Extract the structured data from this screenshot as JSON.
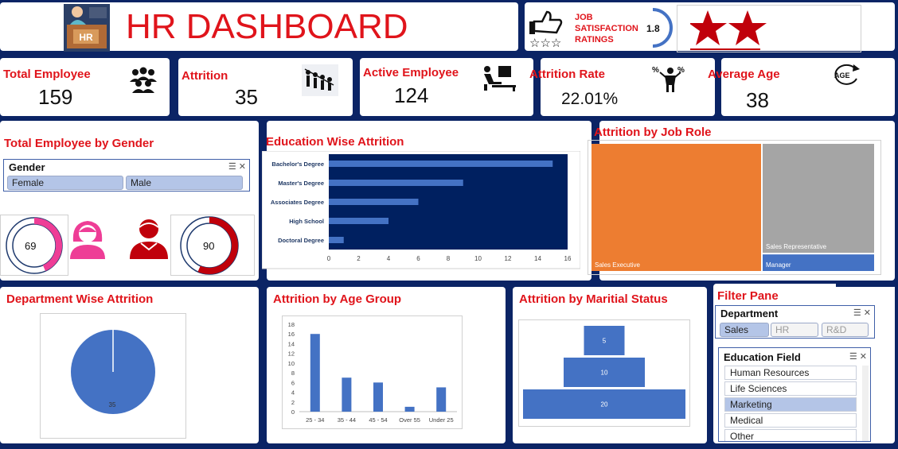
{
  "header": {
    "title": "HR DASHBOARD",
    "rating_label": "JOB SATISFACTION RATINGS",
    "rating_value": "1.8",
    "stars_filled": 2
  },
  "kpis": [
    {
      "label": "Total Employee",
      "value": "159",
      "icon": "people-group-icon"
    },
    {
      "label": "Attrition",
      "value": "35",
      "icon": "attrition-people-icon"
    },
    {
      "label": "Active Employee",
      "value": "124",
      "icon": "desk-worker-icon"
    },
    {
      "label": "Attrition Rate",
      "value": "22.01%",
      "icon": "percent-person-icon"
    },
    {
      "label": "Average Age",
      "value": "38",
      "icon": "age-icon"
    }
  ],
  "gender_panel": {
    "title": "Total Employee by Gender",
    "slicer_title": "Gender",
    "options": [
      "Female",
      "Male"
    ],
    "female_count": "69",
    "male_count": "90",
    "female_color": "#ee3d96",
    "male_color": "#c0000b"
  },
  "education_attrition": {
    "title": "Education Wise Attrition",
    "chart_data": {
      "type": "bar",
      "orientation": "horizontal",
      "categories": [
        "Bachelor's Degree",
        "Master's Degree",
        "Associates Degree",
        "High School",
        "Doctoral Degree"
      ],
      "values": [
        15,
        9,
        6,
        4,
        1
      ],
      "xlim": [
        0,
        16
      ],
      "xticks": [
        "0",
        "2",
        "4",
        "6",
        "8",
        "10",
        "12",
        "14",
        "16"
      ],
      "bar_color": "#4472c4",
      "plot_bg": "#002060"
    }
  },
  "job_role": {
    "title": "Attrition by Job Role",
    "chart_data": {
      "type": "treemap",
      "items": [
        {
          "name": "Sales Executive",
          "value": 21,
          "color": "#ed7d31"
        },
        {
          "name": "Sales Representative",
          "value": 12,
          "color": "#a5a5a5"
        },
        {
          "name": "Manager",
          "value": 2,
          "color": "#4472c4"
        }
      ]
    }
  },
  "department_attrition": {
    "title": "Department Wise Attrition",
    "chart_data": {
      "type": "pie",
      "slices": [
        {
          "name": "Sales",
          "value": 35,
          "color": "#4472c4"
        }
      ],
      "label": "35"
    }
  },
  "age_group": {
    "title": "Attrition by Age Group",
    "chart_data": {
      "type": "bar",
      "categories": [
        "25 - 34",
        "35 - 44",
        "45 - 54",
        "Over 55",
        "Under 25"
      ],
      "values": [
        16,
        7,
        6,
        1,
        5
      ],
      "ylim": [
        0,
        18
      ],
      "yticks": [
        "0",
        "2",
        "4",
        "6",
        "8",
        "10",
        "12",
        "14",
        "16",
        "18"
      ],
      "bar_color": "#4472c4"
    }
  },
  "marital_status": {
    "title": "Attrition by Maritial Status",
    "chart_data": {
      "type": "bar",
      "style": "funnel",
      "values": [
        5,
        10,
        20
      ],
      "labels": [
        "5",
        "10",
        "20"
      ],
      "bar_color": "#4472c4"
    }
  },
  "filter_pane": {
    "title": "Filter Pane",
    "department": {
      "title": "Department",
      "options": [
        "Sales",
        "HR",
        "R&D"
      ],
      "selected": "Sales"
    },
    "education_field": {
      "title": "Education Field",
      "options": [
        "Human Resources",
        "Life Sciences",
        "Marketing",
        "Medical",
        "Other"
      ],
      "selected": "Marketing"
    }
  }
}
